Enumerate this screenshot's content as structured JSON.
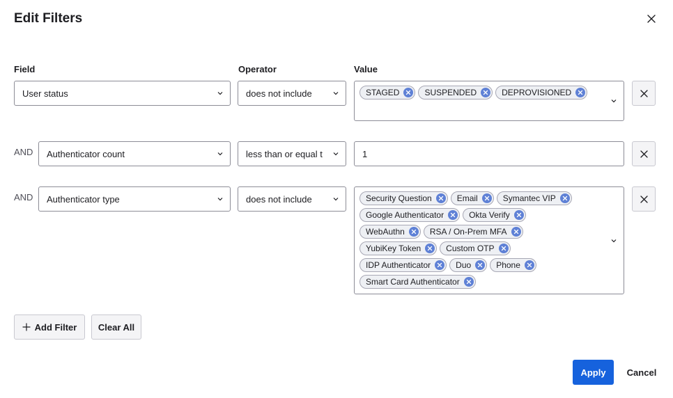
{
  "dialog": {
    "title": "Edit Filters"
  },
  "columns": {
    "field": "Field",
    "operator": "Operator",
    "value": "Value"
  },
  "rows": [
    {
      "conjunction": "",
      "field": "User status",
      "operator": "does not include",
      "value_type": "multi",
      "chips": [
        "STAGED",
        "SUSPENDED",
        "DEPROVISIONED"
      ]
    },
    {
      "conjunction": "AND",
      "field": "Authenticator count",
      "operator": "less than or equal t",
      "value_type": "text",
      "value": "1"
    },
    {
      "conjunction": "AND",
      "field": "Authenticator type",
      "operator": "does not include",
      "value_type": "multi",
      "chips": [
        "Security Question",
        "Email",
        "Symantec VIP",
        "Google Authenticator",
        "Okta Verify",
        "WebAuthn",
        "RSA / On-Prem MFA",
        "YubiKey Token",
        "Custom OTP",
        "IDP Authenticator",
        "Duo",
        "Phone",
        "Smart Card Authenticator"
      ]
    }
  ],
  "actions": {
    "add_filter": "Add Filter",
    "clear_all": "Clear All",
    "apply": "Apply",
    "cancel": "Cancel"
  },
  "icons": {
    "close": "close-icon",
    "chevron": "chevron-down-icon",
    "chip_remove": "chip-remove-icon",
    "row_remove": "row-remove-icon",
    "add": "plus-icon"
  },
  "colors": {
    "primary": "#1662dd",
    "chip_x": "#5f81d6"
  }
}
